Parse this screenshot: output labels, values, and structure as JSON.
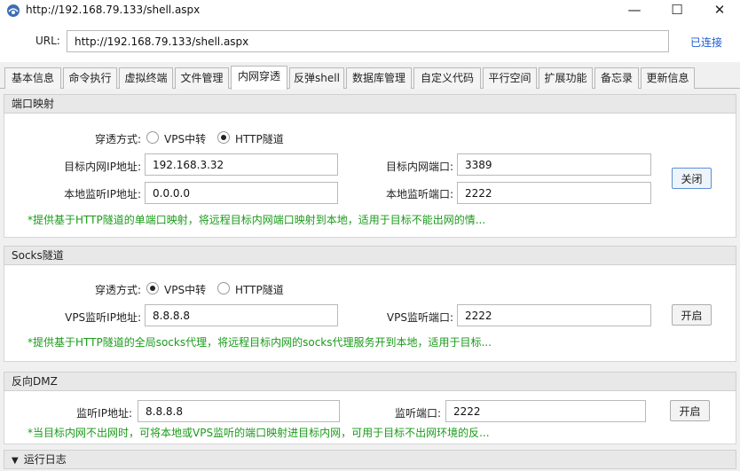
{
  "window": {
    "title": "http://192.168.79.133/shell.aspx",
    "min_glyph": "—",
    "max_glyph": "☐",
    "close_glyph": "✕"
  },
  "urlbar": {
    "label": "URL:",
    "value": "http://192.168.79.133/shell.aspx",
    "status": "已连接"
  },
  "tabs": [
    "基本信息",
    "命令执行",
    "虚拟终端",
    "文件管理",
    "内网穿透",
    "反弹shell",
    "数据库管理",
    "自定义代码",
    "平行空间",
    "扩展功能",
    "备忘录",
    "更新信息"
  ],
  "active_tab": "内网穿透",
  "port_mapping": {
    "header": "端口映射",
    "mode_label": "穿透方式:",
    "options": [
      "VPS中转",
      "HTTP隧道"
    ],
    "selected": "HTTP隧道",
    "target_ip_label": "目标内网IP地址:",
    "target_ip": "192.168.3.32",
    "target_port_label": "目标内网端口:",
    "target_port": "3389",
    "local_ip_label": "本地监听IP地址:",
    "local_ip": "0.0.0.0",
    "local_port_label": "本地监听端口:",
    "local_port": "2222",
    "button": "关闭",
    "note": "*提供基于HTTP隧道的单端口映射，将远程目标内网端口映射到本地，适用于目标不能出网的情..."
  },
  "socks": {
    "header": "Socks隧道",
    "mode_label": "穿透方式:",
    "options": [
      "VPS中转",
      "HTTP隧道"
    ],
    "selected": "VPS中转",
    "vps_ip_label": "VPS监听IP地址:",
    "vps_ip": "8.8.8.8",
    "vps_port_label": "VPS监听端口:",
    "vps_port": "2222",
    "button": "开启",
    "note": "*提供基于HTTP隧道的全局socks代理，将远程目标内网的socks代理服务开到本地，适用于目标..."
  },
  "dmz": {
    "header": "反向DMZ",
    "ip_label": "监听IP地址:",
    "ip": "8.8.8.8",
    "port_label": "监听端口:",
    "port": "2222",
    "button": "开启",
    "note": "*当目标内网不出网时，可将本地或VPS监听的端口映射进目标内网，可用于目标不出网环境的反..."
  },
  "log": {
    "caret": "▼",
    "label": "运行日志"
  }
}
